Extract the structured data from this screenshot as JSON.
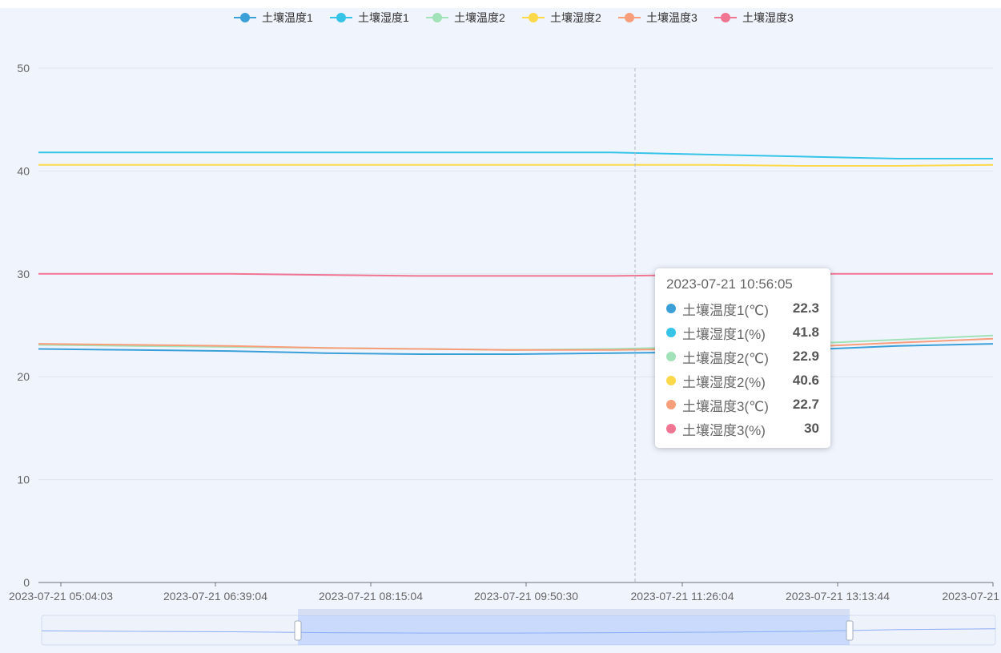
{
  "chart_data": {
    "type": "line",
    "x_ticks": [
      "2023-07-21 05:04:03",
      "2023-07-21 06:39:04",
      "2023-07-21 08:15:04",
      "2023-07-21 09:50:30",
      "2023-07-21 11:26:04",
      "2023-07-21 13:13:44",
      "2023-07-21"
    ],
    "y_ticks": [
      0,
      10,
      20,
      30,
      40,
      50
    ],
    "ylim": [
      0,
      50
    ],
    "grid": true,
    "legend_position": "top-center",
    "series": [
      {
        "name": "土壤温度1",
        "color": "#3ba0d8",
        "x": [
          0,
          0.1,
          0.2,
          0.3,
          0.4,
          0.5,
          0.6,
          0.7,
          0.8,
          0.9,
          1
        ],
        "values": [
          22.7,
          22.6,
          22.5,
          22.3,
          22.2,
          22.2,
          22.3,
          22.4,
          22.6,
          23.0,
          23.2
        ]
      },
      {
        "name": "土壤湿度1",
        "color": "#36c3e8",
        "x": [
          0,
          0.1,
          0.2,
          0.3,
          0.4,
          0.5,
          0.6,
          0.7,
          0.8,
          0.9,
          1
        ],
        "values": [
          41.8,
          41.8,
          41.8,
          41.8,
          41.8,
          41.8,
          41.8,
          41.6,
          41.4,
          41.2,
          41.2
        ]
      },
      {
        "name": "土壤温度2",
        "color": "#a2e2b8",
        "x": [
          0,
          0.1,
          0.2,
          0.3,
          0.4,
          0.5,
          0.6,
          0.7,
          0.8,
          0.9,
          1
        ],
        "values": [
          23.1,
          23.0,
          22.9,
          22.8,
          22.7,
          22.6,
          22.7,
          22.9,
          23.2,
          23.6,
          24.0
        ]
      },
      {
        "name": "土壤湿度2",
        "color": "#fbd94b",
        "x": [
          0,
          0.1,
          0.2,
          0.3,
          0.4,
          0.5,
          0.6,
          0.7,
          0.8,
          0.9,
          1
        ],
        "values": [
          40.6,
          40.6,
          40.6,
          40.6,
          40.6,
          40.6,
          40.6,
          40.6,
          40.5,
          40.5,
          40.6
        ]
      },
      {
        "name": "土壤温度3",
        "color": "#f89e7a",
        "x": [
          0,
          0.1,
          0.2,
          0.3,
          0.4,
          0.5,
          0.6,
          0.7,
          0.8,
          0.9,
          1
        ],
        "values": [
          23.2,
          23.1,
          23.0,
          22.8,
          22.7,
          22.6,
          22.6,
          22.7,
          22.9,
          23.3,
          23.7
        ]
      },
      {
        "name": "土壤湿度3",
        "color": "#f07592",
        "x": [
          0,
          0.1,
          0.2,
          0.3,
          0.4,
          0.5,
          0.6,
          0.7,
          0.8,
          0.9,
          1
        ],
        "values": [
          30,
          30,
          30,
          29.9,
          29.8,
          29.8,
          29.8,
          29.9,
          30,
          30,
          30
        ]
      }
    ]
  },
  "tooltip": {
    "title": "2023-07-21 10:56:05",
    "rows": [
      {
        "label": "土壤温度1(℃)",
        "value": "22.3",
        "color": "#3ba0d8"
      },
      {
        "label": "土壤湿度1(%)",
        "value": "41.8",
        "color": "#36c3e8"
      },
      {
        "label": "土壤温度2(℃)",
        "value": "22.9",
        "color": "#a2e2b8"
      },
      {
        "label": "土壤湿度2(%)",
        "value": "40.6",
        "color": "#fbd94b"
      },
      {
        "label": "土壤温度3(℃)",
        "value": "22.7",
        "color": "#f89e7a"
      },
      {
        "label": "土壤湿度3(%)",
        "value": "30",
        "color": "#f07592"
      }
    ]
  },
  "zoom": {
    "start": 0.27,
    "end": 0.85
  }
}
